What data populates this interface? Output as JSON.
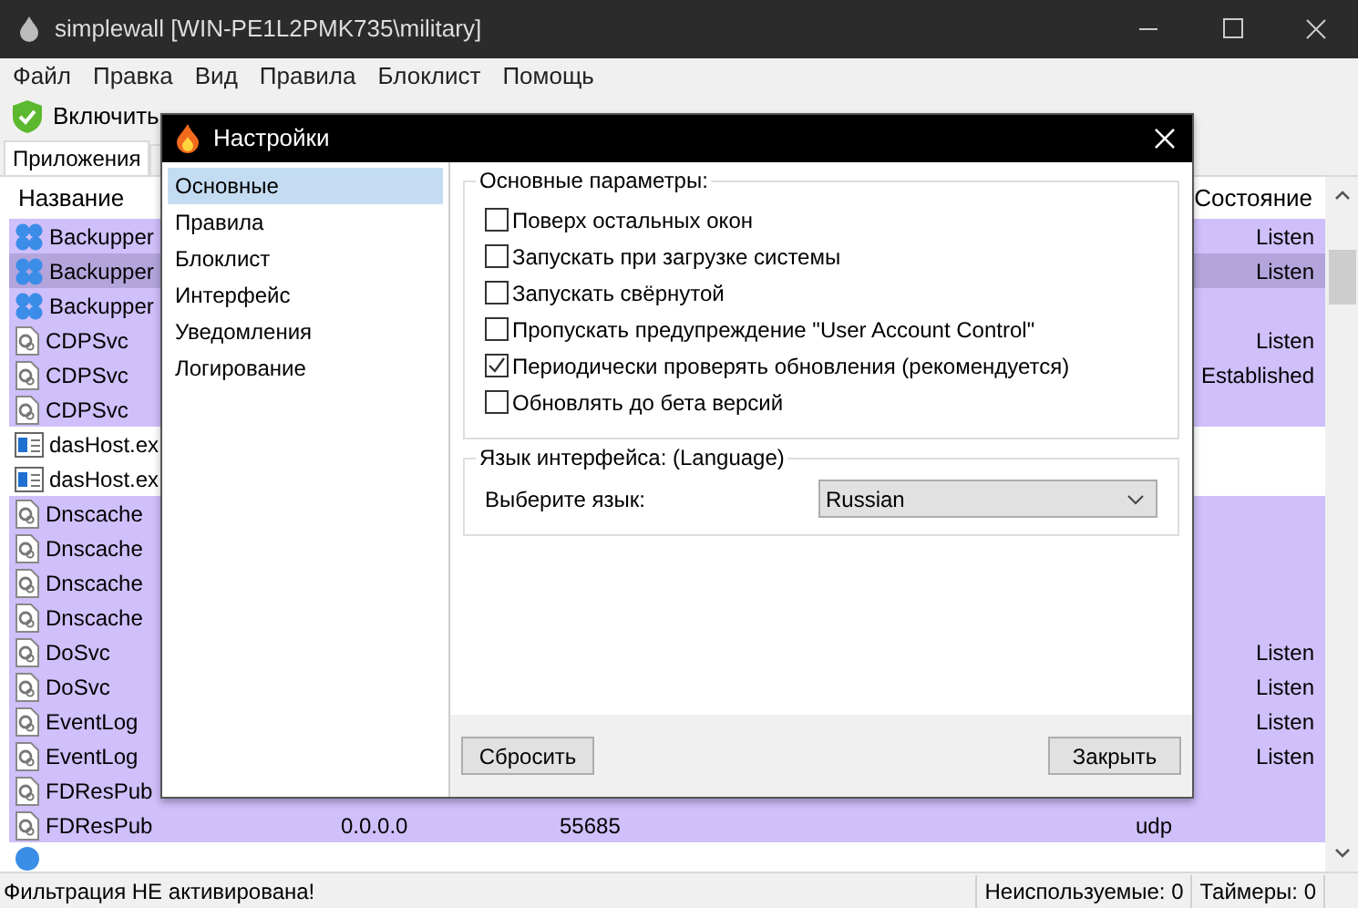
{
  "window": {
    "title": "simplewall [WIN-PE1L2PMK735\\military]"
  },
  "menu": [
    "Файл",
    "Правка",
    "Вид",
    "Правила",
    "Блоклист",
    "Помощь"
  ],
  "toolbar": {
    "enable_button": "Включить"
  },
  "tabs": [
    {
      "label": "Приложения",
      "selected": true
    },
    {
      "selected": false
    }
  ],
  "table": {
    "columns": [
      "Название",
      "Состояние"
    ],
    "rows": [
      {
        "kind": "backupper",
        "name": "Backupper",
        "state": "Listen",
        "highlighted": true,
        "selected": false
      },
      {
        "kind": "backupper",
        "name": "Backupper",
        "state": "Listen",
        "highlighted": true,
        "selected": true
      },
      {
        "kind": "backupper",
        "name": "Backupper",
        "highlighted": true,
        "selected": false
      },
      {
        "kind": "service",
        "name": "CDPSvc",
        "state": "Listen",
        "highlighted": true,
        "selected": false
      },
      {
        "kind": "service",
        "name": "CDPSvc",
        "state": "Established",
        "highlighted": true,
        "selected": false
      },
      {
        "kind": "service",
        "name": "CDPSvc",
        "highlighted": true,
        "selected": false
      },
      {
        "kind": "exe",
        "name": "dasHost.ex",
        "highlighted": false,
        "selected": false
      },
      {
        "kind": "exe",
        "name": "dasHost.ex",
        "highlighted": false,
        "selected": false
      },
      {
        "kind": "service",
        "name": "Dnscache",
        "highlighted": true,
        "selected": false
      },
      {
        "kind": "service",
        "name": "Dnscache",
        "highlighted": true,
        "selected": false
      },
      {
        "kind": "service",
        "name": "Dnscache",
        "highlighted": true,
        "selected": false
      },
      {
        "kind": "service",
        "name": "Dnscache",
        "highlighted": true,
        "selected": false
      },
      {
        "kind": "service",
        "name": "DoSvc",
        "state": "Listen",
        "highlighted": true,
        "selected": false
      },
      {
        "kind": "service",
        "name": "DoSvc",
        "state": "Listen",
        "highlighted": true,
        "selected": false
      },
      {
        "kind": "service",
        "name": "EventLog",
        "state": "Listen",
        "highlighted": true,
        "selected": false
      },
      {
        "kind": "service",
        "name": "EventLog",
        "state": "Listen",
        "highlighted": true,
        "selected": false
      },
      {
        "kind": "service",
        "name": "FDResPub",
        "highlighted": true,
        "selected": false
      },
      {
        "kind": "service",
        "name": "FDResPub",
        "address": "0.0.0.0",
        "port": "55685",
        "protocol": "udp",
        "highlighted": true,
        "selected": false
      },
      {
        "kind": "globe",
        "highlighted": false,
        "selected": false
      }
    ]
  },
  "status_bar": [
    "Фильтрация НЕ активирована!",
    "Неиспользуемые: 0",
    "Таймеры: 0"
  ],
  "dialog": {
    "title": "Настройки",
    "sidebar": [
      {
        "label": "Основные",
        "selected": true
      },
      {
        "label": "Правила",
        "selected": false
      },
      {
        "label": "Блоклист",
        "selected": false
      },
      {
        "label": "Интерфейс",
        "selected": false
      },
      {
        "label": "Уведомления",
        "selected": false
      },
      {
        "label": "Логирование",
        "selected": false
      }
    ],
    "general_group": {
      "title": "Основные параметры:",
      "options": [
        {
          "label": "Поверх остальных окон",
          "checked": false
        },
        {
          "label": "Запускать при загрузке системы",
          "checked": false
        },
        {
          "label": "Запускать свёрнутой",
          "checked": false
        },
        {
          "label": "Пропускать предупреждение \"User Account Control\"",
          "checked": false
        },
        {
          "label": "Периодически проверять обновления (рекомендуется)",
          "checked": true
        },
        {
          "label": "Обновлять до бета версий",
          "checked": false
        }
      ]
    },
    "language_group": {
      "title": "Язык интерфейса: (Language)",
      "label": "Выберите язык:",
      "value": "Russian"
    },
    "buttons": [
      "Сбросить",
      "Закрыть"
    ]
  }
}
